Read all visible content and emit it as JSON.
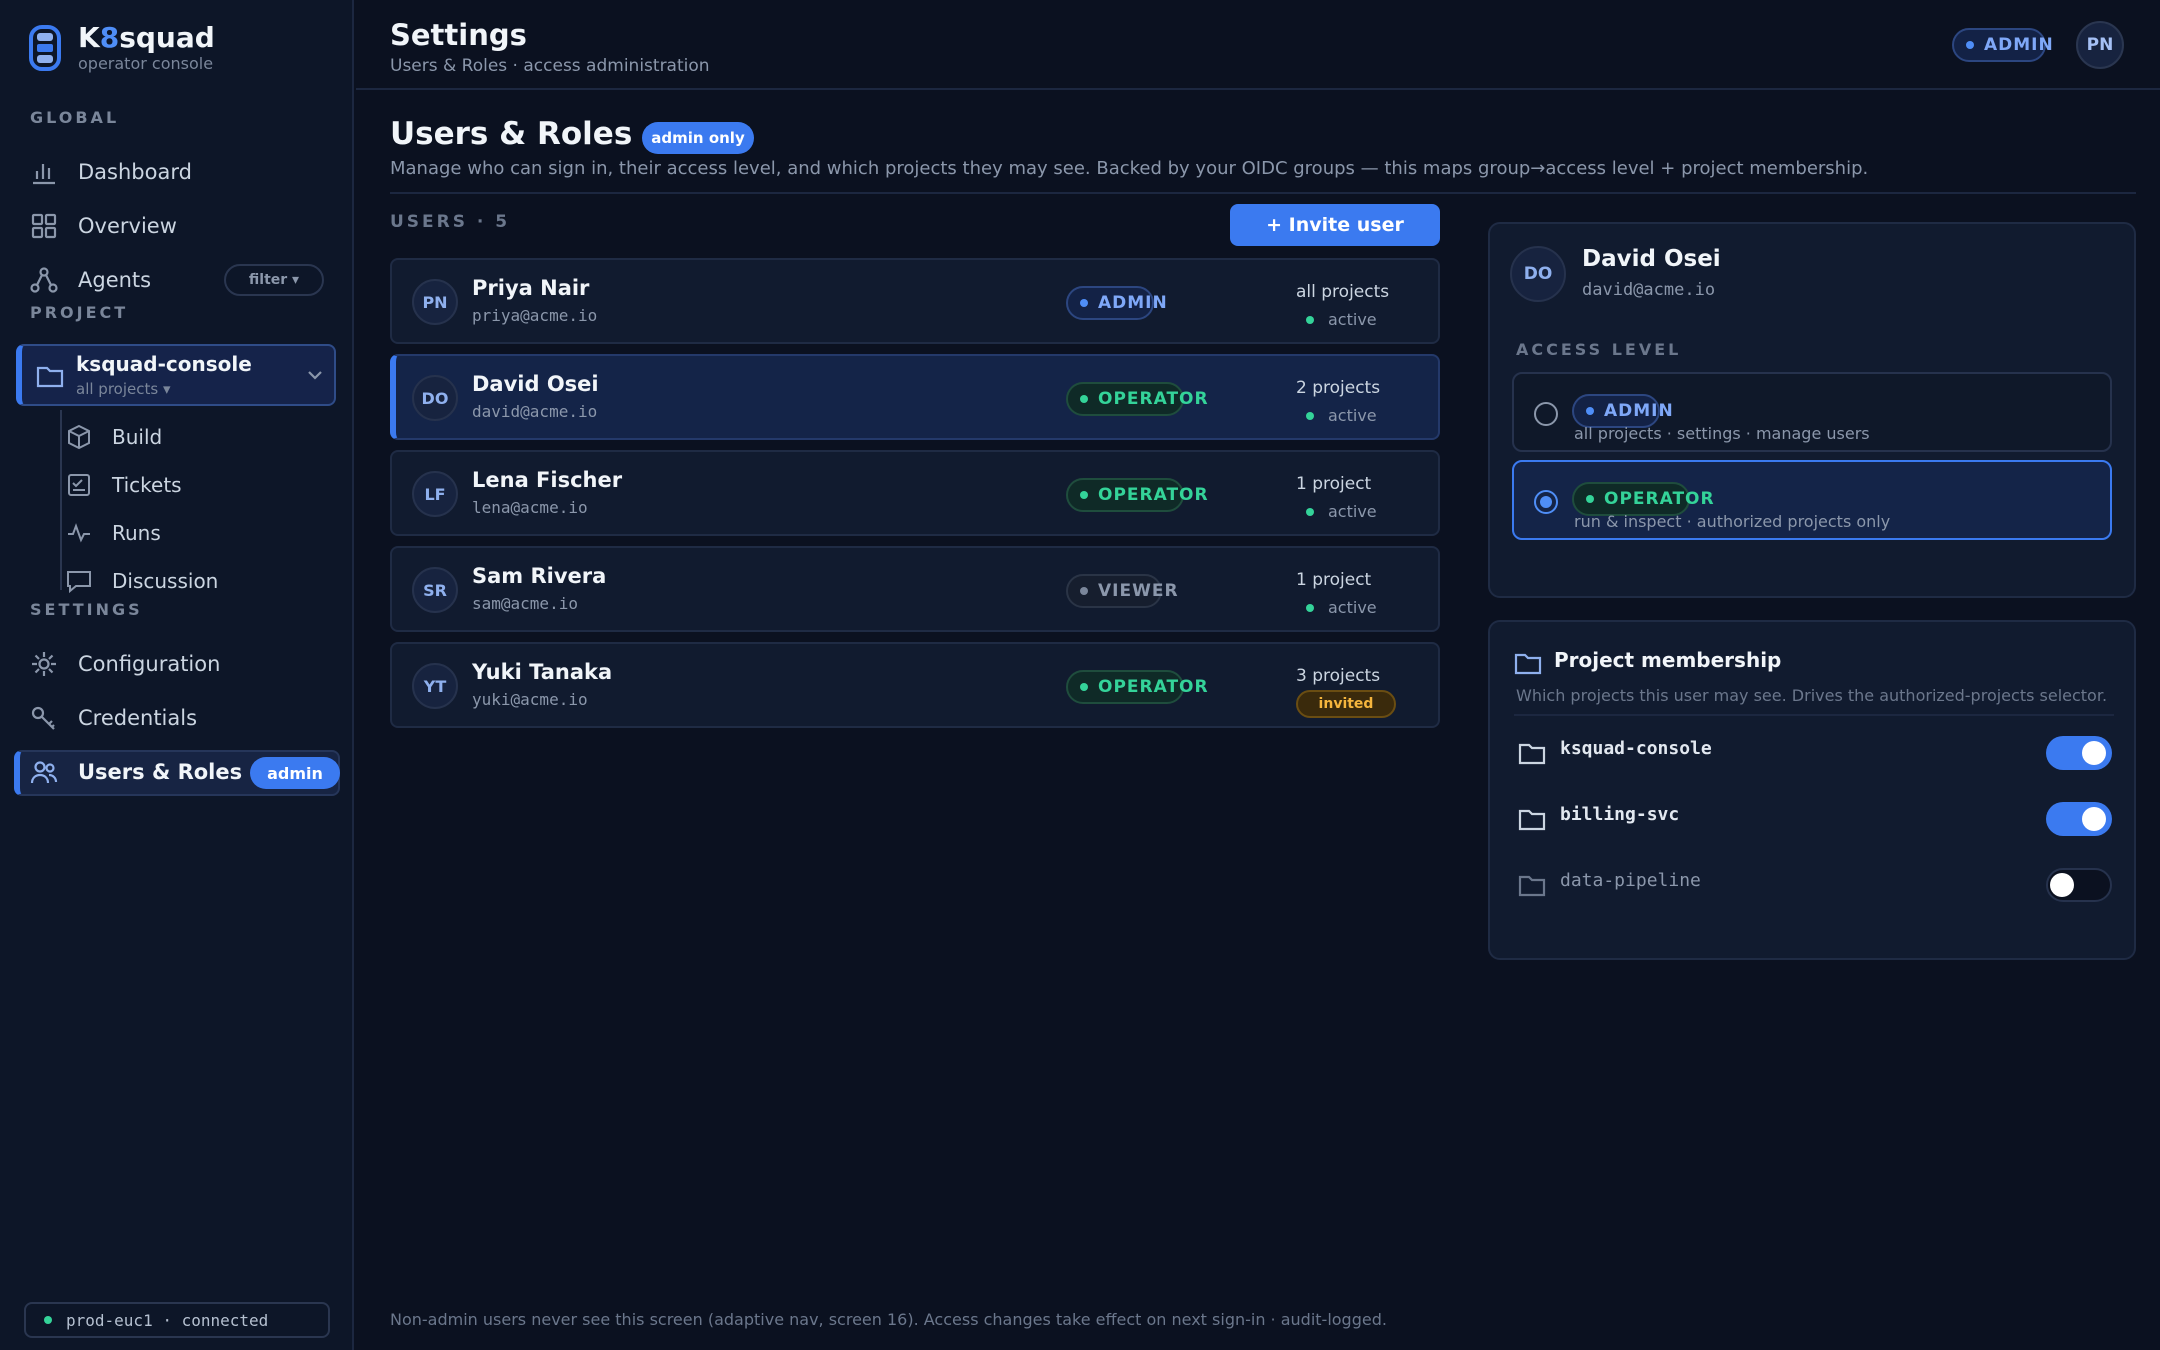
{
  "brand": {
    "name_pre": "K",
    "name_hl": "8",
    "name_post": "squad",
    "subtitle": "operator console"
  },
  "sidebar": {
    "global_label": "GLOBAL",
    "project_label": "PROJECT",
    "settings_label": "SETTINGS",
    "global_items": [
      {
        "label": "Dashboard",
        "icon": "bar-chart-icon"
      },
      {
        "label": "Overview",
        "icon": "grid-icon"
      },
      {
        "label": "Agents",
        "icon": "nodes-icon"
      }
    ],
    "agents_filter": "filter ▾",
    "project": {
      "name": "ksquad-console",
      "scope": "all projects ▾"
    },
    "project_items": [
      {
        "label": "Build",
        "icon": "cube-icon"
      },
      {
        "label": "Tickets",
        "icon": "ticket-icon"
      },
      {
        "label": "Runs",
        "icon": "pulse-icon"
      },
      {
        "label": "Discussion",
        "icon": "chat-icon"
      }
    ],
    "settings_items": [
      {
        "label": "Configuration",
        "icon": "gear-icon"
      },
      {
        "label": "Credentials",
        "icon": "key-icon"
      },
      {
        "label": "Users & Roles",
        "icon": "users-icon",
        "badge": "admin"
      }
    ],
    "connection": "prod-euc1 · connected"
  },
  "header": {
    "title": "Settings",
    "subtitle": "Users & Roles · access administration",
    "role": "ADMIN",
    "avatar": "PN"
  },
  "main": {
    "title": "Users & Roles",
    "badge": "admin only",
    "description": "Manage who can sign in, their access level, and which projects they may see. Backed by your OIDC groups — this maps group→access level + project membership.",
    "users_count": "USERS · 5",
    "invite_label": "+ Invite user",
    "users": [
      {
        "initials": "PN",
        "name": "Priya Nair",
        "email": "priya@acme.io",
        "role": "ADMIN",
        "projects": "all projects",
        "status": "active"
      },
      {
        "initials": "DO",
        "name": "David Osei",
        "email": "david@acme.io",
        "role": "OPERATOR",
        "projects": "2 projects",
        "status": "active"
      },
      {
        "initials": "LF",
        "name": "Lena Fischer",
        "email": "lena@acme.io",
        "role": "OPERATOR",
        "projects": "1 project",
        "status": "active"
      },
      {
        "initials": "SR",
        "name": "Sam Rivera",
        "email": "sam@acme.io",
        "role": "VIEWER",
        "projects": "1 project",
        "status": "active"
      },
      {
        "initials": "YT",
        "name": "Yuki Tanaka",
        "email": "yuki@acme.io",
        "role": "OPERATOR",
        "projects": "3 projects",
        "status": "invited"
      }
    ],
    "footnote": "Non-admin users never see this screen (adaptive nav, screen 16). Access changes take effect on next sign-in · audit-logged."
  },
  "detail": {
    "initials": "DO",
    "name": "David Osei",
    "email": "david@acme.io",
    "access_label": "ACCESS LEVEL",
    "options": [
      {
        "role": "ADMIN",
        "desc": "all projects · settings · manage users",
        "checked": false
      },
      {
        "role": "OPERATOR",
        "desc": "run & inspect · authorized projects only",
        "checked": true
      }
    ]
  },
  "membership": {
    "title": "Project membership",
    "description": "Which projects this user may see. Drives the authorized-projects selector.",
    "projects": [
      {
        "name": "ksquad-console",
        "enabled": true
      },
      {
        "name": "billing-svc",
        "enabled": true
      },
      {
        "name": "data-pipeline",
        "enabled": false
      }
    ]
  },
  "colors": {
    "accent": "#3b7af0",
    "operator": "#34d399",
    "invited": "#f5b53d",
    "background": "#0b1120"
  }
}
